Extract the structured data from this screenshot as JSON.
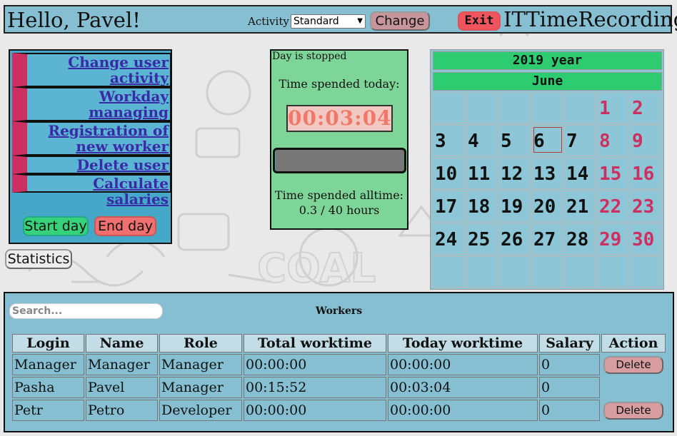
{
  "header": {
    "greeting": "Hello, Pavel!",
    "activity_label": "Activity",
    "activity_value": "Standard",
    "change_label": "Change",
    "exit_label": "Exit",
    "app_title": "ITTimeRecording"
  },
  "menu": {
    "items": [
      {
        "line1": "Change user",
        "line2": "activity"
      },
      {
        "line1": "Workday",
        "line2": "managing"
      },
      {
        "line1": "Registration of",
        "line2": "new worker"
      },
      {
        "line1": "Delete user"
      },
      {
        "line1": "Calculate salaries"
      }
    ],
    "start_label": "Start day",
    "end_label": "End day",
    "statistics_label": "Statistics"
  },
  "day": {
    "status": "Day is stopped",
    "spent_today_label": "Time spended today:",
    "timer": "00:03:04",
    "alltime_label": "Time spended alltime:",
    "alltime_value": "0.3 / 40 hours",
    "progress_fraction": 0.0075
  },
  "calendar": {
    "year": "2019 year",
    "month": "June",
    "days": [
      "",
      "",
      "",
      "",
      "",
      "1",
      "2",
      "3",
      "4",
      "5",
      "6",
      "7",
      "8",
      "9",
      "10",
      "11",
      "12",
      "13",
      "14",
      "15",
      "16",
      "17",
      "18",
      "19",
      "20",
      "21",
      "22",
      "23",
      "24",
      "25",
      "26",
      "27",
      "28",
      "29",
      "30",
      "",
      "",
      "",
      "",
      "",
      "",
      ""
    ],
    "today": "6",
    "weekend_color": "#cc2f60"
  },
  "workers": {
    "search_placeholder": "Search...",
    "title": "Workers",
    "headers": [
      "Login",
      "Name",
      "Role",
      "Total worktime",
      "Today worktime",
      "Salary",
      "Action"
    ],
    "delete_label": "Delete",
    "rows": [
      {
        "login": "Manager",
        "name": "Manager",
        "role": "Manager",
        "total": "00:00:00",
        "today": "00:00:00",
        "salary": "0",
        "deletable": true
      },
      {
        "login": "Pasha",
        "name": "Pavel",
        "role": "Manager",
        "total": "00:15:52",
        "today": "00:03:04",
        "salary": "0",
        "deletable": false
      },
      {
        "login": "Petr",
        "name": "Petro",
        "role": "Developer",
        "total": "00:00:00",
        "today": "00:00:00",
        "salary": "0",
        "deletable": true
      }
    ]
  }
}
